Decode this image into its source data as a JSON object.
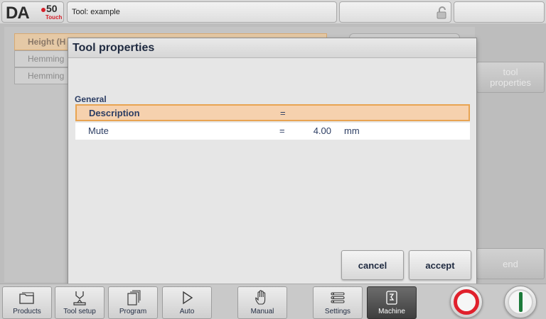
{
  "header": {
    "logo": {
      "brand": "DA",
      "model": "50",
      "sub": "Touch"
    },
    "title": "Tool: example",
    "lock_icon": "unlocked-padlock-icon"
  },
  "background": {
    "list": [
      {
        "label": "Height (H",
        "selected": true
      },
      {
        "label": "Hemming",
        "selected": false
      },
      {
        "label": "Hemming",
        "selected": false
      }
    ],
    "side_buttons": {
      "tool_properties": "tool\nproperties",
      "end": "end"
    }
  },
  "dialog": {
    "title": "Tool properties",
    "section": "General",
    "rows": [
      {
        "name": "Description",
        "eq": "=",
        "value": "",
        "unit": "",
        "selected": true
      },
      {
        "name": "Mute",
        "eq": "=",
        "value": "4.00",
        "unit": "mm",
        "selected": false
      }
    ],
    "cancel_label": "cancel",
    "accept_label": "accept"
  },
  "nav": {
    "items": [
      {
        "label": "Products",
        "icon": "folder-icon"
      },
      {
        "label": "Tool setup",
        "icon": "tool-setup-icon"
      },
      {
        "label": "Program",
        "icon": "program-pages-icon"
      },
      {
        "label": "Auto",
        "icon": "play-icon"
      },
      {
        "label": "Manual",
        "icon": "hand-icon"
      },
      {
        "label": "Settings",
        "icon": "settings-list-icon"
      },
      {
        "label": "Machine",
        "icon": "machine-icon",
        "active": true
      }
    ],
    "stop_icon": "stop-icon",
    "start_icon": "start-icon"
  },
  "colors": {
    "selection_fill": "#f6d1ae",
    "selection_border": "#e8a452",
    "stop_red": "#e0202c",
    "start_green": "#1c7a3a",
    "active_nav": "#4a4a4a"
  }
}
